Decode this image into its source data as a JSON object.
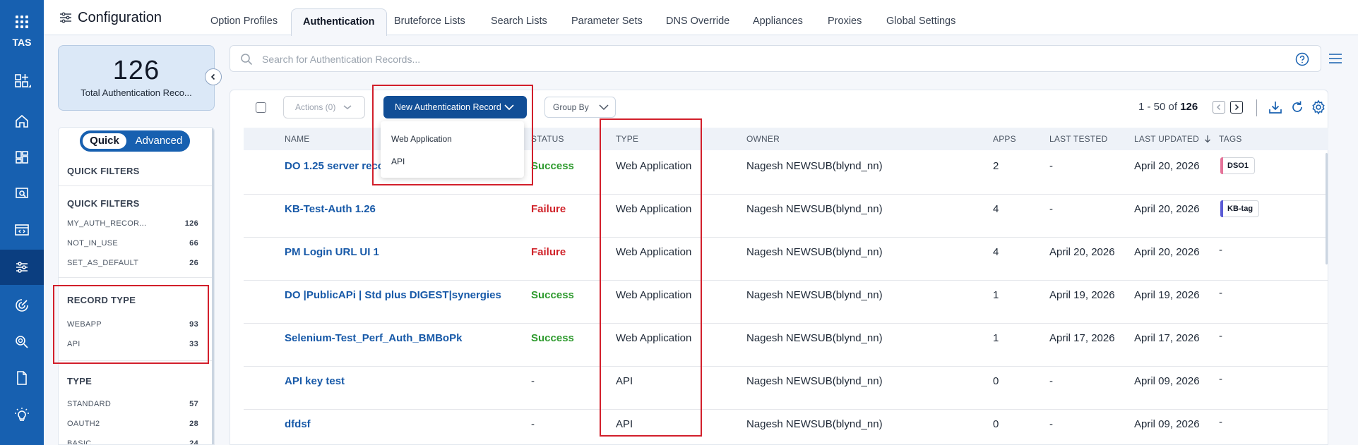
{
  "rail": {
    "label": "TAS"
  },
  "header": {
    "title": "Configuration",
    "tabs": [
      "Option Profiles",
      "Authentication",
      "Bruteforce Lists",
      "Search Lists",
      "Parameter Sets",
      "DNS Override",
      "Appliances",
      "Proxies",
      "Global Settings"
    ]
  },
  "summary": {
    "count": "126",
    "label": "Total Authentication Reco..."
  },
  "filters": {
    "mode_quick": "Quick",
    "mode_advanced": "Advanced",
    "quick_heading": "QUICK FILTERS",
    "quick_sub": "QUICK FILTERS",
    "quick_items": [
      {
        "label": "MY_AUTH_RECOR...",
        "count": "126"
      },
      {
        "label": "NOT_IN_USE",
        "count": "66"
      },
      {
        "label": "SET_AS_DEFAULT",
        "count": "26"
      }
    ],
    "record_type_heading": "RECORD TYPE",
    "record_type_items": [
      {
        "label": "WEBAPP",
        "count": "93"
      },
      {
        "label": "API",
        "count": "33"
      }
    ],
    "type_heading": "TYPE",
    "type_items": [
      {
        "label": "STANDARD",
        "count": "57"
      },
      {
        "label": "OAUTH2",
        "count": "28"
      },
      {
        "label": "BASIC",
        "count": "24"
      }
    ]
  },
  "search": {
    "placeholder": "Search for Authentication Records..."
  },
  "toolbar": {
    "actions_label": "Actions (0)",
    "new_label": "New Authentication Record",
    "group_label": "Group By",
    "pager_range": "1 - 50 of",
    "pager_total": "126"
  },
  "new_menu": [
    "Web Application",
    "API"
  ],
  "table": {
    "columns": [
      "NAME",
      "STATUS",
      "TYPE",
      "OWNER",
      "APPS",
      "LAST TESTED",
      "LAST UPDATED",
      "TAGS"
    ],
    "rows": [
      {
        "name": "DO 1.25 server record",
        "status": "Success",
        "type": "Web Application",
        "owner": "Nagesh NEWSUB(blynd_nn)",
        "apps": "2",
        "last_tested": "-",
        "last_updated": "April 20, 2026",
        "tag": "DSO1"
      },
      {
        "name": "KB-Test-Auth 1.26",
        "status": "Failure",
        "type": "Web Application",
        "owner": "Nagesh NEWSUB(blynd_nn)",
        "apps": "4",
        "last_tested": "-",
        "last_updated": "April 20, 2026",
        "tag": "KB-tag"
      },
      {
        "name": "PM Login URL UI 1",
        "status": "Failure",
        "type": "Web Application",
        "owner": "Nagesh NEWSUB(blynd_nn)",
        "apps": "4",
        "last_tested": "April 20, 2026",
        "last_updated": "April 20, 2026",
        "tag": "-"
      },
      {
        "name": "DO |PublicAPi | Std plus DIGEST|synergies",
        "status": "Success",
        "type": "Web Application",
        "owner": "Nagesh NEWSUB(blynd_nn)",
        "apps": "1",
        "last_tested": "April 19, 2026",
        "last_updated": "April 19, 2026",
        "tag": "-"
      },
      {
        "name": "Selenium-Test_Perf_Auth_BMBoPk",
        "status": "Success",
        "type": "Web Application",
        "owner": "Nagesh NEWSUB(blynd_nn)",
        "apps": "1",
        "last_tested": "April 17, 2026",
        "last_updated": "April 17, 2026",
        "tag": "-"
      },
      {
        "name": "API key test",
        "status": "-",
        "type": "API",
        "owner": "Nagesh NEWSUB(blynd_nn)",
        "apps": "0",
        "last_tested": "-",
        "last_updated": "April 09, 2026",
        "tag": "-"
      },
      {
        "name": "dfdsf",
        "status": "-",
        "type": "API",
        "owner": "Nagesh NEWSUB(blynd_nn)",
        "apps": "0",
        "last_tested": "-",
        "last_updated": "April 09, 2026",
        "tag": "-"
      }
    ]
  },
  "colors": {
    "brand": "#1760b0",
    "success": "#2f9b2f",
    "failure": "#d0232a",
    "highlight": "#d21f2b",
    "tag_dso1": "#e57399",
    "tag_kb": "#5b5bd6"
  }
}
